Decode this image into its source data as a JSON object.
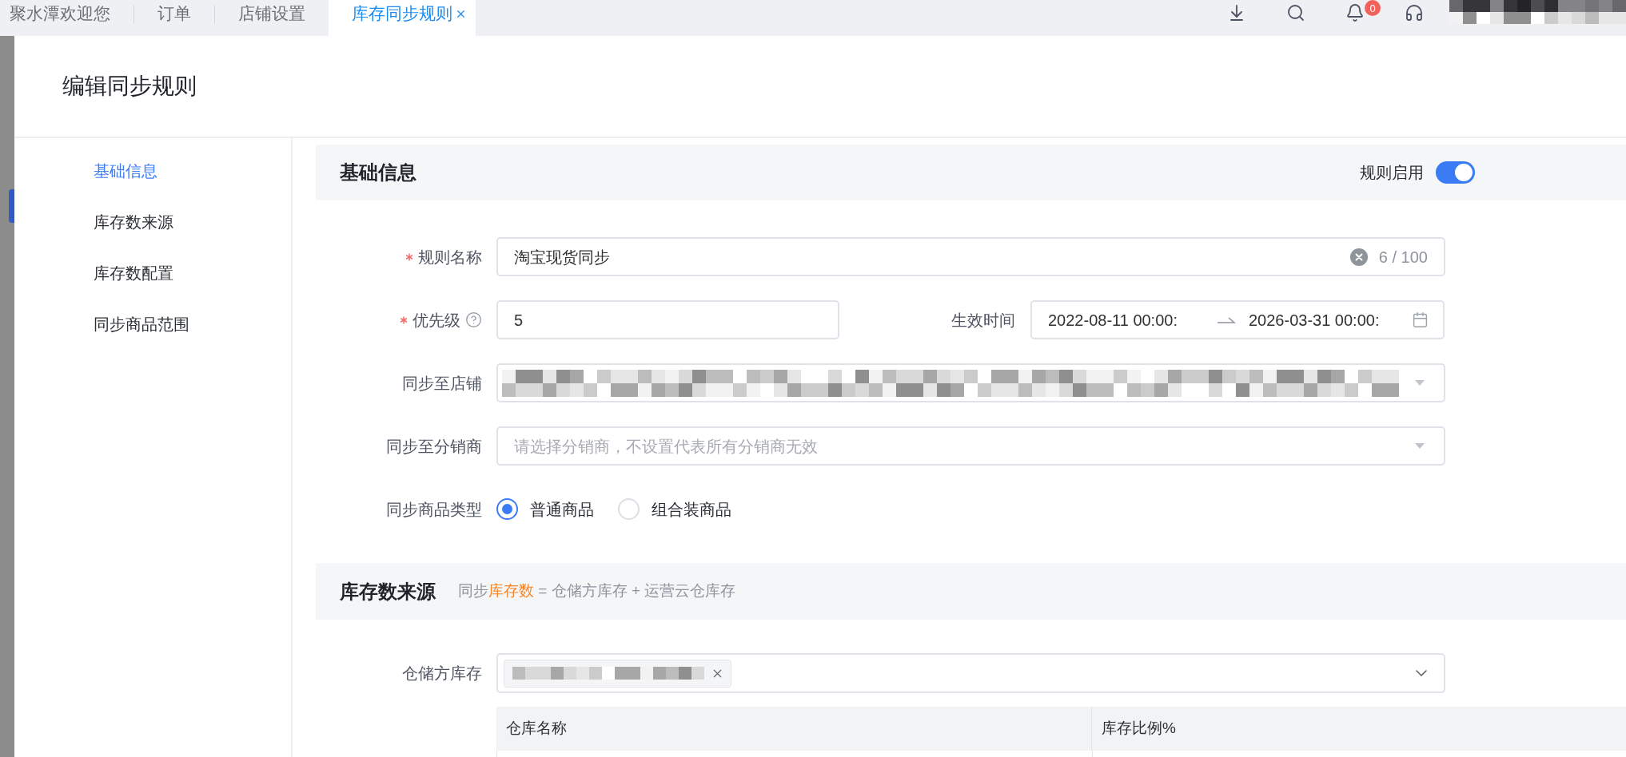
{
  "top_bar": {
    "tabs": [
      {
        "label": "聚水潭欢迎您",
        "selected": false,
        "closable": false
      },
      {
        "label": "订单",
        "selected": false,
        "closable": false
      },
      {
        "label": "店铺设置",
        "selected": false,
        "closable": false
      },
      {
        "label": "库存同步规则",
        "selected": true,
        "closable": true
      }
    ],
    "notification_count": "0"
  },
  "drawer": {
    "title": "编辑同步规则"
  },
  "nav": {
    "items": [
      {
        "label": "基础信息",
        "selected": true
      },
      {
        "label": "库存数来源",
        "selected": false
      },
      {
        "label": "库存数配置",
        "selected": false
      },
      {
        "label": "同步商品范围",
        "selected": false
      }
    ]
  },
  "basic_info": {
    "title": "基础信息",
    "enable_label": "规则启用",
    "enabled": true,
    "rule_name": {
      "label": "规则名称",
      "required": true,
      "value": "淘宝现货同步",
      "counter": "6 / 100"
    },
    "priority": {
      "label": "优先级",
      "required": true,
      "value": "5"
    },
    "effective_time": {
      "label": "生效时间",
      "start": "2022-08-11 00:00:",
      "end": "2026-03-31 00:00:"
    },
    "shops": {
      "label": "同步至店铺"
    },
    "distributors": {
      "label": "同步至分销商",
      "placeholder": "请选择分销商，不设置代表所有分销商无效"
    },
    "product_type": {
      "label": "同步商品类型",
      "options": [
        {
          "label": "普通商品",
          "selected": true
        },
        {
          "label": "组合装商品",
          "selected": false
        }
      ]
    }
  },
  "stock_source": {
    "title": "库存数来源",
    "formula": [
      {
        "text": "同步",
        "highlight": false
      },
      {
        "text": "库存数",
        "highlight": true
      },
      {
        "text": " = 仓储方库存 + 运营云仓库存",
        "highlight": false
      }
    ],
    "warehouse": {
      "label": "仓储方库存"
    },
    "table": {
      "columns": [
        "仓库名称",
        "库存比例%"
      ]
    }
  }
}
